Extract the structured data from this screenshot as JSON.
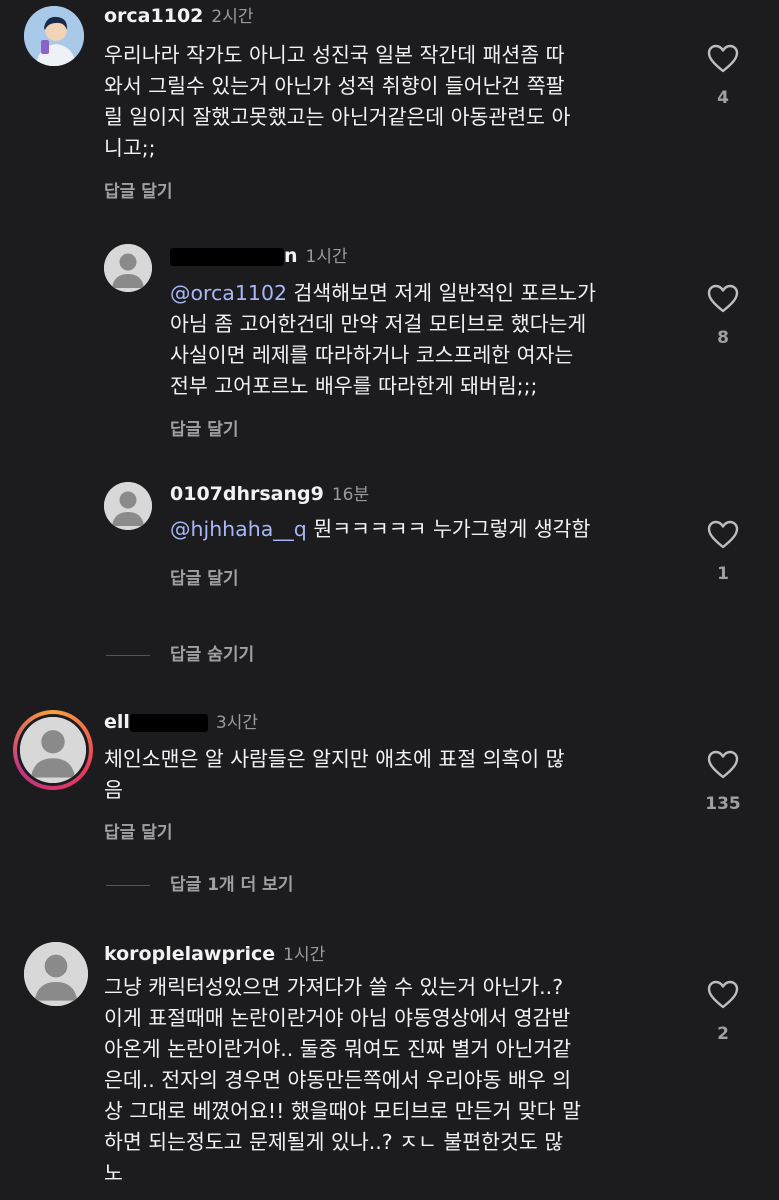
{
  "comments": [
    {
      "username": "orca1102",
      "time": "2시간",
      "lines": [
        "우리나라 작가도 아니고 성진국 일본 작간데 패션좀 따",
        "와서 그릴수 있는거 아닌가 성적 취향이 들어난건 쪽팔",
        "릴 일이지 잘했고못했고는 아닌거같은데 아동관련도 아",
        "니고;;"
      ],
      "reply_label": "답글 달기",
      "likes": "4"
    },
    {
      "username_suffix": "n",
      "time": "1시간",
      "mention": "@orca1102",
      "lines": [
        " 검색해보면 저게 일반적인 포르노가",
        "아님 좀 고어한건데 만약 저걸 모티브로 했다는게",
        "사실이면 레제를 따라하거나 코스프레한 여자는",
        "전부 고어포르노 배우를 따라한게 돼버림;;;"
      ],
      "reply_label": "답글 달기",
      "likes": "8"
    },
    {
      "username": "0107dhrsang9",
      "time": "16분",
      "mention": "@hjhhaha__q",
      "lines": [
        " 뭔ㅋㅋㅋㅋㅋ 누가그렇게 생각함"
      ],
      "reply_label": "답글 달기",
      "likes": "1"
    },
    {
      "username_prefix": "ell",
      "time": "3시간",
      "lines": [
        "체인소맨은 알 사람들은 알지만 애초에 표절 의혹이 많",
        "음"
      ],
      "reply_label": "답글 달기",
      "likes": "135"
    },
    {
      "username": "koroplelawprice",
      "time": "1시간",
      "lines": [
        "그냥 캐릭터성있으면 가져다가 쓸 수 있는거 아닌가..?",
        "이게 표절때매 논란이란거야 아님 야동영상에서 영감받",
        "아온게 논란이란거야.. 둘중 뭐여도 진짜 별거 아닌거같",
        "은데.. 전자의 경우면 야동만든쪽에서 우리야동 배우 의",
        "상 그대로 베꼈어요!! 했을때야 모티브로 만든거 맞다 말",
        "하면 되는정도고 문제될게 있나..? ㅈㄴ 불편한것도 많",
        "노"
      ],
      "likes": "2"
    }
  ],
  "hide_replies_label": "답글 숨기기",
  "view_more_replies_label": "답글 1개 더 보기",
  "icons": {
    "like": "heart-outline-icon",
    "avatar_default": "default-avatar-icon"
  },
  "colors": {
    "background": "#1c1c1e",
    "mention": "#a8b7f5",
    "secondary_text": "#a0a0a0"
  }
}
